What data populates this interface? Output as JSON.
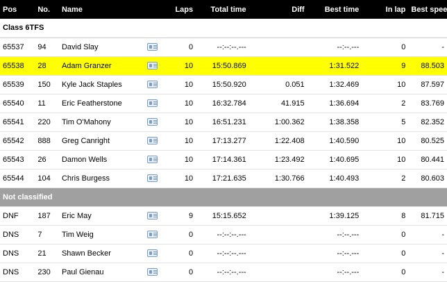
{
  "headers": {
    "pos": "Pos",
    "no": "No.",
    "name": "Name",
    "laps": "Laps",
    "total_time": "Total time",
    "diff": "Diff",
    "best_time": "Best time",
    "in_lap": "In lap",
    "best_speed": "Best speed"
  },
  "class_label": "Class 6TFS",
  "not_classified_label": "Not classified",
  "highlight_color": "#ffff00",
  "icon": "driver-card-icon",
  "classified": [
    {
      "pos": "65537",
      "no": "94",
      "name": "David Slay",
      "laps": "0",
      "total": "--:--:--.---",
      "diff": "",
      "best": "--:--.---",
      "in_lap": "0",
      "speed": "-",
      "highlight": false
    },
    {
      "pos": "65538",
      "no": "28",
      "name": "Adam Granzer",
      "laps": "10",
      "total": "15:50.869",
      "diff": "",
      "best": "1:31.522",
      "in_lap": "9",
      "speed": "88.503",
      "highlight": true
    },
    {
      "pos": "65539",
      "no": "150",
      "name": "Kyle Jack Staples",
      "laps": "10",
      "total": "15:50.920",
      "diff": "0.051",
      "best": "1:32.469",
      "in_lap": "10",
      "speed": "87.597",
      "highlight": false
    },
    {
      "pos": "65540",
      "no": "11",
      "name": "Eric Featherstone",
      "laps": "10",
      "total": "16:32.784",
      "diff": "41.915",
      "best": "1:36.694",
      "in_lap": "2",
      "speed": "83.769",
      "highlight": false
    },
    {
      "pos": "65541",
      "no": "220",
      "name": "Tim O'Mahony",
      "laps": "10",
      "total": "16:51.231",
      "diff": "1:00.362",
      "best": "1:38.358",
      "in_lap": "5",
      "speed": "82.352",
      "highlight": false
    },
    {
      "pos": "65542",
      "no": "888",
      "name": "Greg Canright",
      "laps": "10",
      "total": "17:13.277",
      "diff": "1:22.408",
      "best": "1:40.590",
      "in_lap": "10",
      "speed": "80.525",
      "highlight": false
    },
    {
      "pos": "65543",
      "no": "26",
      "name": "Damon Wells",
      "laps": "10",
      "total": "17:14.361",
      "diff": "1:23.492",
      "best": "1:40.695",
      "in_lap": "10",
      "speed": "80.441",
      "highlight": false
    },
    {
      "pos": "65544",
      "no": "104",
      "name": "Chris Burgess",
      "laps": "10",
      "total": "17:21.635",
      "diff": "1:30.766",
      "best": "1:40.493",
      "in_lap": "2",
      "speed": "80.603",
      "highlight": false
    }
  ],
  "not_classified": [
    {
      "pos": "DNF",
      "no": "187",
      "name": "Eric May",
      "laps": "9",
      "total": "15:15.652",
      "diff": "",
      "best": "1:39.125",
      "in_lap": "8",
      "speed": "81.715"
    },
    {
      "pos": "DNS",
      "no": "7",
      "name": "Tim Weig",
      "laps": "0",
      "total": "--:--:--.---",
      "diff": "",
      "best": "--:--.---",
      "in_lap": "0",
      "speed": "-"
    },
    {
      "pos": "DNS",
      "no": "21",
      "name": "Shawn Becker",
      "laps": "0",
      "total": "--:--:--.---",
      "diff": "",
      "best": "--:--.---",
      "in_lap": "0",
      "speed": "-"
    },
    {
      "pos": "DNS",
      "no": "230",
      "name": "Paul Gienau",
      "laps": "0",
      "total": "--:--:--.---",
      "diff": "",
      "best": "--:--.---",
      "in_lap": "0",
      "speed": "-"
    }
  ]
}
